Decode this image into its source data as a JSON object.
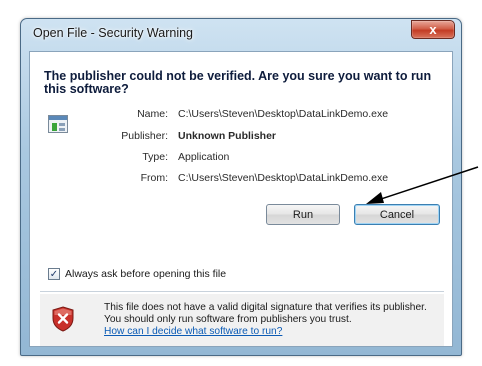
{
  "window": {
    "title": "Open File - Security Warning",
    "close_label": "x"
  },
  "dialog": {
    "question": "The publisher could not be verified.  Are you sure you want to run this software?",
    "fields": [
      {
        "label": "Name:",
        "value": "C:\\Users\\Steven\\Desktop\\DataLinkDemo.exe",
        "bold": false
      },
      {
        "label": "Publisher:",
        "value": "Unknown Publisher",
        "bold": true
      },
      {
        "label": "Type:",
        "value": "Application",
        "bold": false
      },
      {
        "label": "From:",
        "value": "C:\\Users\\Steven\\Desktop\\DataLinkDemo.exe",
        "bold": false
      }
    ],
    "buttons": {
      "run_label": "Run",
      "cancel_label": "Cancel"
    },
    "checkbox": {
      "label": "Always ask before opening this file",
      "checked": true,
      "check_glyph": "✓"
    },
    "warning": {
      "text": "This file does not have a valid digital signature that verifies its publisher.  You should only run software from publishers you trust.",
      "link": "How can I decide what software to run?"
    }
  },
  "colors": {
    "title_bar": "#a9c8e0",
    "close_button": "#c33c24",
    "link": "#0b5bb5",
    "shield": "#c8302a"
  },
  "icons": [
    "file-icon",
    "close-icon",
    "shield-icon"
  ],
  "annotation": {
    "type": "arrow",
    "points_to": "cancel-button"
  }
}
